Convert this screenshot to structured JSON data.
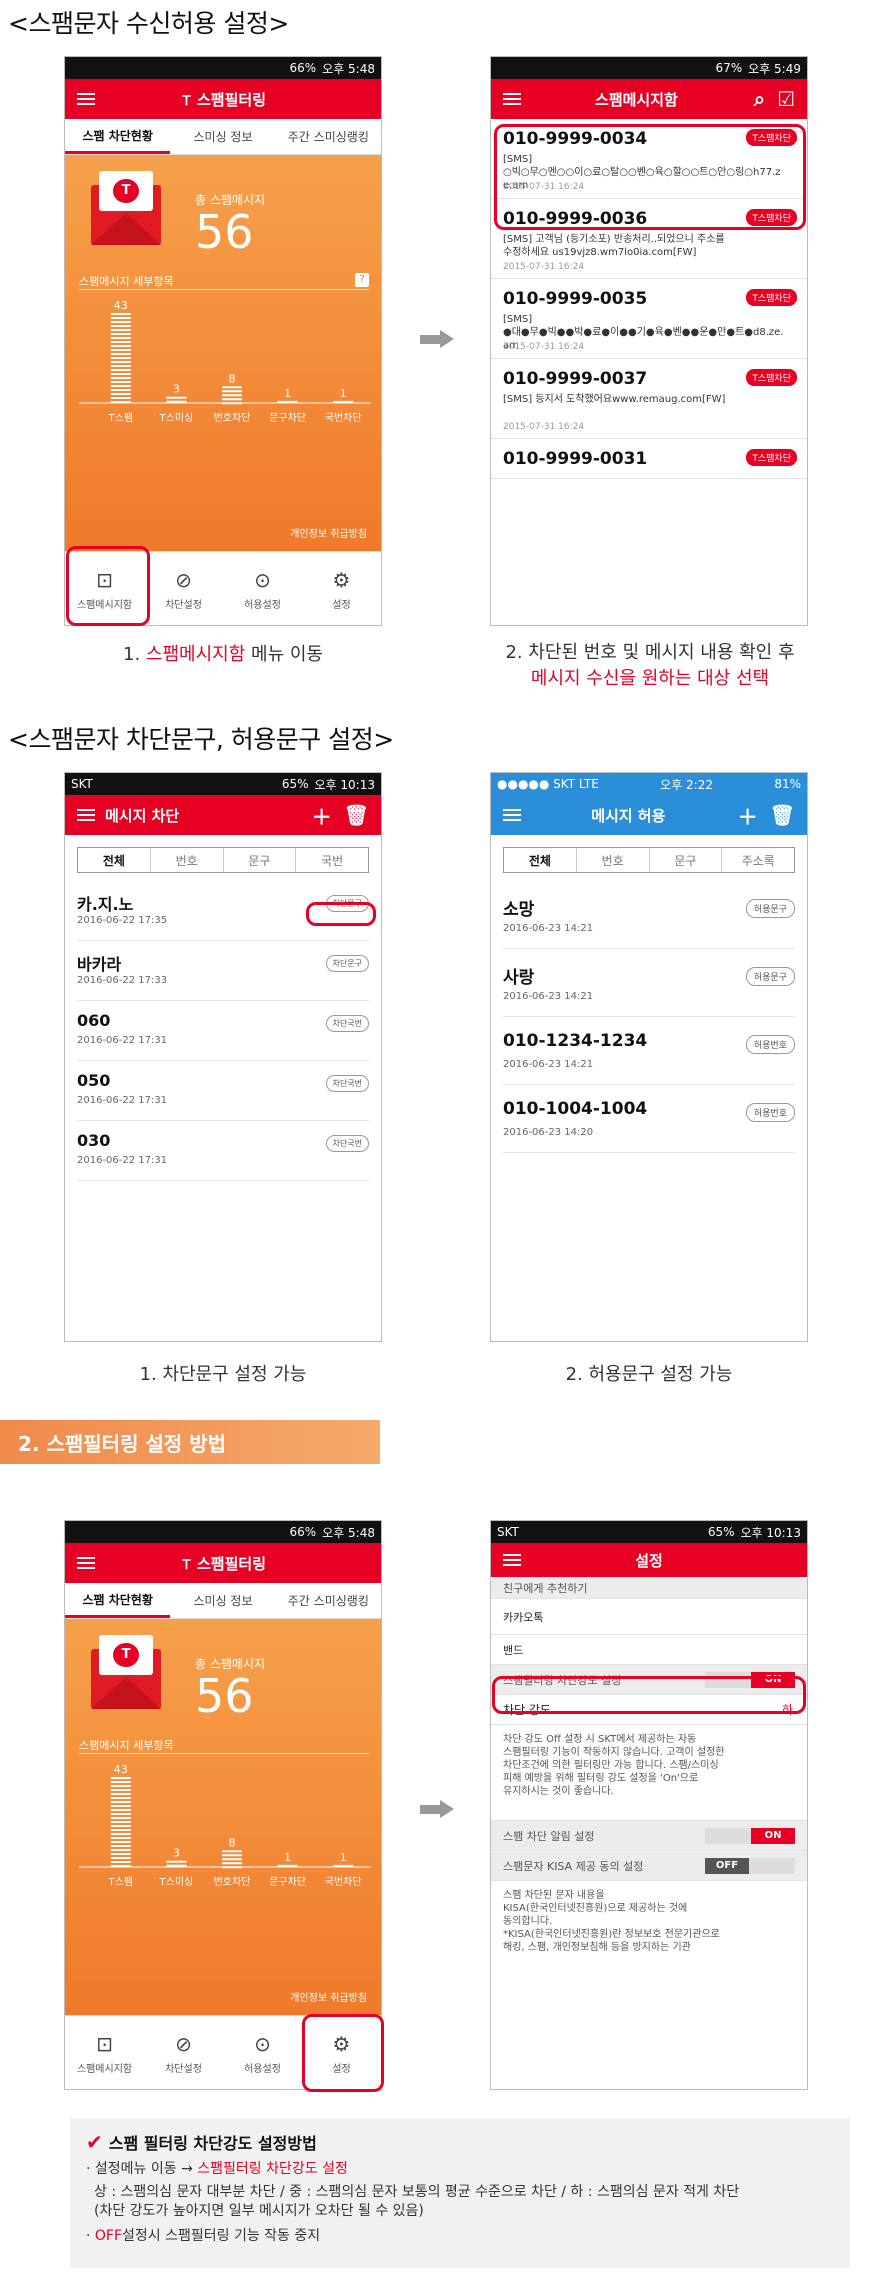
{
  "section1_title": "<스팸문자 수신허용 설정>",
  "section2_title": "<스팸문자 차단문구, 허용문구 설정>",
  "banner": "2. 스팸필터링 설정 방법",
  "status": {
    "time1": "오후 5:48",
    "time2": "오후 5:49",
    "time3": "오후 10:13",
    "bat1": "66%",
    "bat2": "67%",
    "bat3": "65%",
    "carrier": "SKT",
    "ios_carrier": "●●●●● SKT  LTE",
    "ios_time": "오후 2:22",
    "ios_bat": "81%"
  },
  "main_app": {
    "title": "스팸필터링",
    "tabs": [
      "스팸 차단현황",
      "스미싱 정보",
      "주간 스미싱랭킹"
    ],
    "total_label": "총 스팸메시지",
    "total": "56",
    "detail_label": "스팸메시지 세부항목",
    "privacy": "개인정보 취급방침",
    "nav": [
      "스팸메시지함",
      "차단설정",
      "허용설정",
      "설정"
    ]
  },
  "chart_data": {
    "type": "bar",
    "categories": [
      "T스팸",
      "T스미싱",
      "번호차단",
      "문구차단",
      "국번차단"
    ],
    "values": [
      43,
      3,
      8,
      1,
      1
    ]
  },
  "inbox": {
    "title": "스팸메시지함",
    "tag": "T스팸차단",
    "messages": [
      {
        "num": "010-9999-0034",
        "body": "[SMS]\n○빅○무○멘○○이○료○탈○○벤○육○할○○트○안○링○h77.z\ne.am",
        "date": "2015-07-31 16:24"
      },
      {
        "num": "010-9999-0036",
        "body": "[SMS] 고객님 (등기소포) 반송처리..되었으니 주소를\n수정하세요 us19vjz8.wm7lo0ia.com[FW]",
        "date": "2015-07-31 16:24"
      },
      {
        "num": "010-9999-0035",
        "body": "[SMS]\n●대●무●빅●●박●료●이●●기●육●벤●●운●만●트●d8.ze.\nam",
        "date": "2015-07-31 16:24"
      },
      {
        "num": "010-9999-0037",
        "body": "[SMS] 등지서 도착했어요www.remaug.com[FW]",
        "date": "2015-07-31 16:24"
      },
      {
        "num": "010-9999-0031",
        "body": "",
        "date": ""
      }
    ]
  },
  "caption1": {
    "pre": "1. ",
    "red": "스팸메시지함",
    "post": " 메뉴 이동"
  },
  "caption2": {
    "line1": "2. 차단된 번호 및 메시지 내용 확인 후",
    "line2": "메시지 수신을 원하는 대상 선택"
  },
  "block": {
    "title": "메시지 차단",
    "tabs": [
      "전체",
      "번호",
      "문구",
      "국번"
    ],
    "rows": [
      {
        "nm": "카.지.노",
        "dt": "2016-06-22 17:35",
        "pill": "차단문구"
      },
      {
        "nm": "바카라",
        "dt": "2016-06-22 17:33",
        "pill": "차단문구"
      },
      {
        "nm": "060",
        "dt": "2016-06-22 17:31",
        "pill": "차단국번"
      },
      {
        "nm": "050",
        "dt": "2016-06-22 17:31",
        "pill": "차단국번"
      },
      {
        "nm": "030",
        "dt": "2016-06-22 17:31",
        "pill": "차단국번"
      }
    ]
  },
  "allow": {
    "title": "메시지 허용",
    "tabs": [
      "전체",
      "번호",
      "문구",
      "주소록"
    ],
    "rows": [
      {
        "nm": "소망",
        "dt": "2016-06-23 14:21",
        "pill": "허용문구"
      },
      {
        "nm": "사랑",
        "dt": "2016-06-23 14:21",
        "pill": "허용문구"
      },
      {
        "nm": "010-1234-1234",
        "dt": "2016-06-23 14:21",
        "pill": "허용번호"
      },
      {
        "nm": "010-1004-1004",
        "dt": "2016-06-23 14:20",
        "pill": "허용번호"
      }
    ]
  },
  "caption3": "1. 차단문구 설정 가능",
  "caption4": "2. 허용문구 설정 가능",
  "settings": {
    "title": "설정",
    "recommend": "친구에게 추천하기",
    "kakao": "카카오톡",
    "band": "밴드",
    "strength_setting": "스팸필터링 차단강도 설정",
    "on": "ON",
    "off": "OFF",
    "strength": "차단 강도",
    "strength_val": "하",
    "desc1": "차단 강도 Off 설정 시 SKT에서 제공하는 자동\n스팸필터링 기능이 작동하지 않습니다. 고객이 설정한\n차단조건에 의한 필터링만 가능 합니다. 스팸/스미싱\n피해 예방을 위해 필터링 강도 설정을 'On'으로\n유지하시는 것이 좋습니다.",
    "alarm": "스팸 차단 알림 설정",
    "kisa": "스팸문자 KISA 제공 동의 설정",
    "desc2": "스팸 차단된 문자 내용을\nKISA(한국인터넷진흥원)으로 제공하는 것에\n동의합니다.\n*KISA(한국인터넷진흥원)란 정보보호 전문기관으로\n해킹, 스팸, 개인정보침해 등을 방지하는 기관"
  },
  "note": {
    "heading": "스팸 필터링 차단강도 설정방법",
    "l1_pre": "· 설정메뉴 이동 → ",
    "l1_red": "스팸필터링 차단강도 설정",
    "l2": "상 : 스팸의심 문자 대부분 차단 / 중 : 스팸의심 문자 보통의 평균 수준으로 차단 / 하 : 스팸의심 문자 적게 차단",
    "l3": "(차단 강도가 높아지면 일부 메시지가 오차단 될 수 있음)",
    "l4_pre": "· ",
    "l4_red": "OFF",
    "l4_post": "설정시 스팸필터링 기능 작동 중지"
  },
  "colors": {
    "accent": "#e60023",
    "orange": "#f08a2b",
    "ios_blue": "#2a8fd8"
  }
}
